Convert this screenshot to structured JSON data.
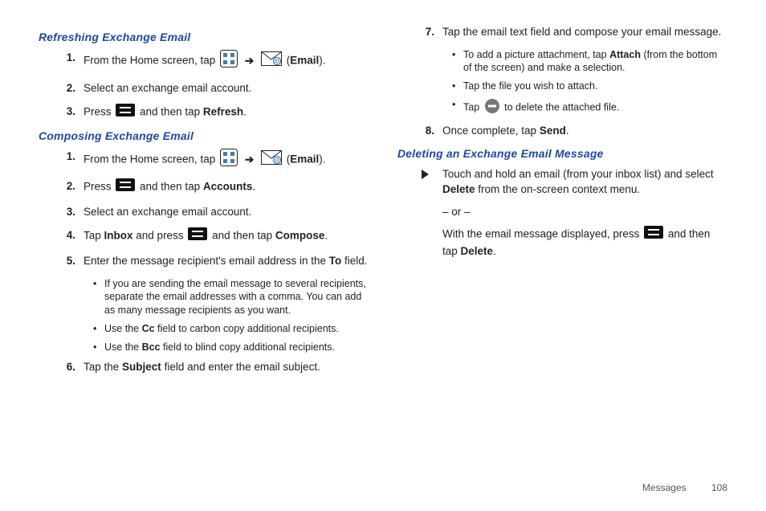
{
  "sections": {
    "refreshing_head": "Refreshing Exchange Email",
    "composing_head": "Composing Exchange Email",
    "deleting_head": "Deleting an Exchange Email Message"
  },
  "text": {
    "from_home_pre": "From the Home screen, tap ",
    "email_label": "Email",
    "select_exchange": "Select an exchange email account.",
    "press_pre": "Press ",
    "then_tap_refresh": " and then tap ",
    "refresh": "Refresh",
    "then_tap_accounts": " and then tap ",
    "accounts": "Accounts",
    "tap_inbox_pre": "Tap ",
    "inbox": "Inbox",
    "and_press": " and press ",
    "then_tap_compose": " and then tap ",
    "compose": "Compose",
    "enter_recipient_pre": "Enter the message recipient's email address in the ",
    "to_field": "To",
    "field_suffix": " field.",
    "sub_multi": "If you are sending the email message to several recipients, separate the email addresses with a comma. You can add as many message recipients as you want.",
    "sub_cc_pre": "Use the ",
    "cc": "Cc",
    "sub_cc_post": " field to carbon copy additional recipients.",
    "sub_bcc_pre": "Use the ",
    "bcc": "Bcc",
    "sub_bcc_post": " field to blind copy additional recipients.",
    "tap_subject_pre": "Tap the ",
    "subject": "Subject",
    "tap_subject_post": " field and enter the email subject.",
    "tap_compose_body": "Tap the email text field and compose your email message.",
    "attach_pre": "To add a picture attachment, tap ",
    "attach": "Attach",
    "attach_post": " (from the bottom of the screen) and make a selection.",
    "tap_file": "Tap the file you wish to attach.",
    "tap_del_pre": "Tap ",
    "tap_del_post": " to delete the attached file.",
    "once_complete_pre": "Once complete, tap ",
    "send": "Send",
    "touch_hold_pre": "Touch and hold an email (from your inbox list) and select ",
    "delete": "Delete",
    "touch_hold_post": " from the on-screen context menu.",
    "or": "– or –",
    "with_msg_pre": "With the email message displayed, press ",
    "with_msg_mid": " and then tap ",
    "period": "."
  },
  "nums": {
    "n1": "1.",
    "n2": "2.",
    "n3": "3.",
    "n4": "4.",
    "n5": "5.",
    "n6": "6.",
    "n7": "7.",
    "n8": "8."
  },
  "footer": {
    "section": "Messages",
    "page": "108"
  }
}
